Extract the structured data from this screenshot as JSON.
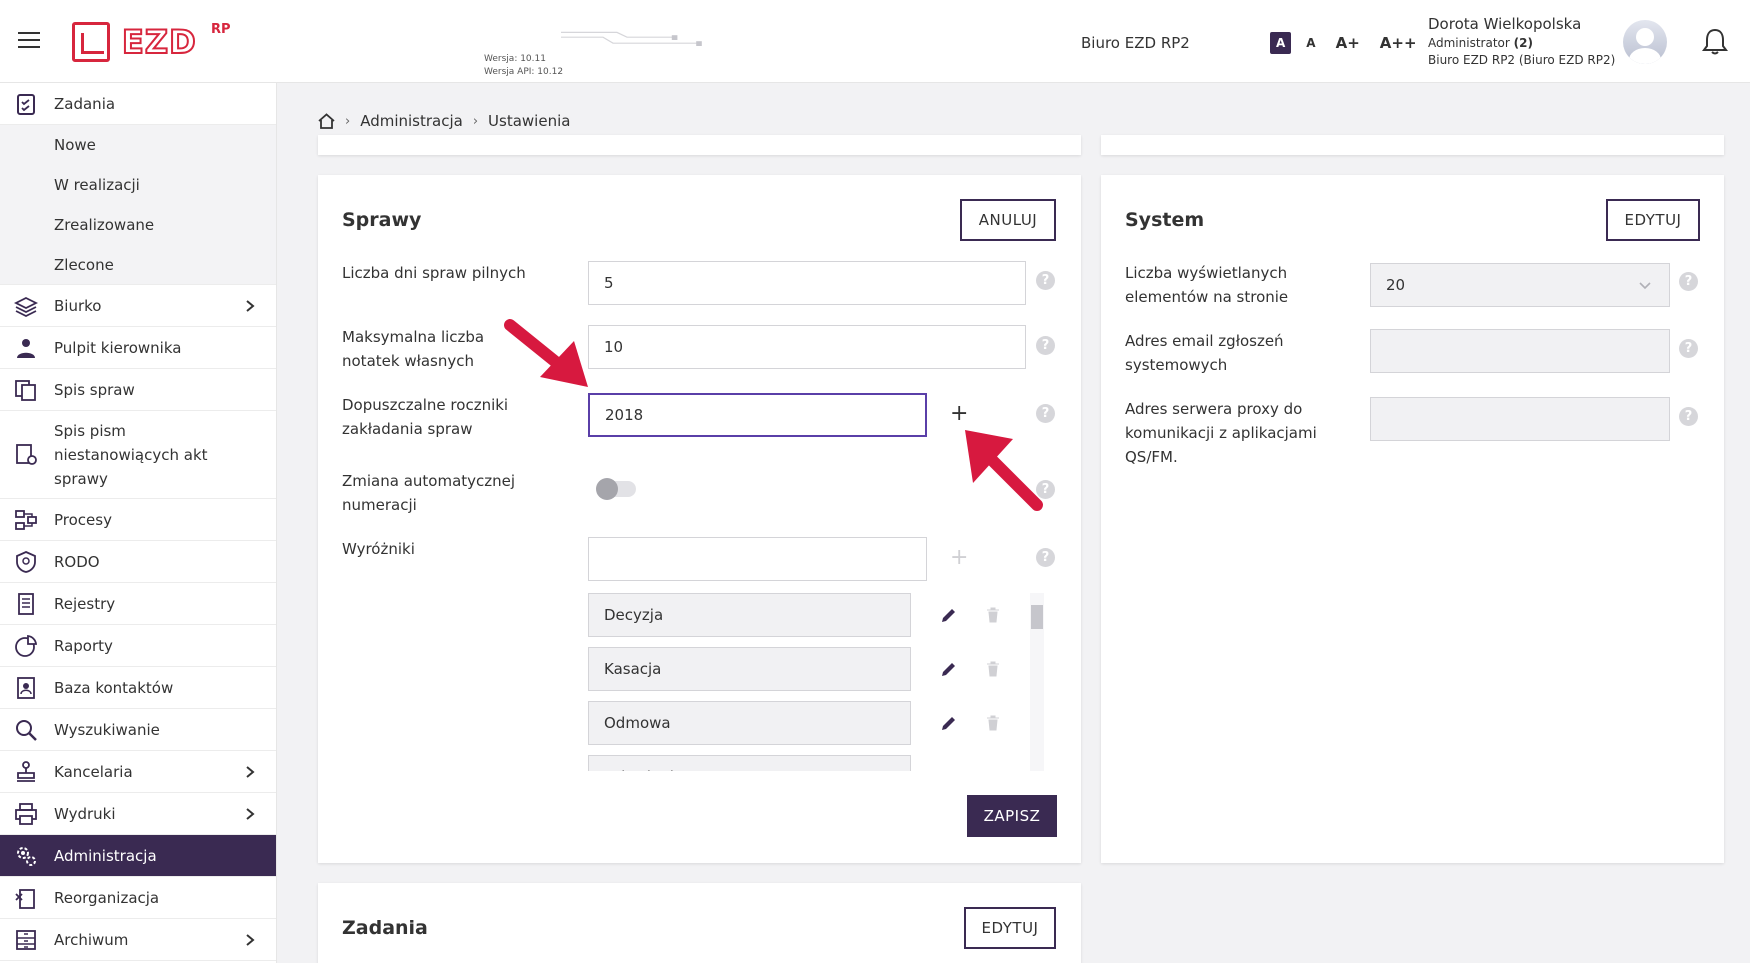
{
  "header": {
    "logo_text": "EZD",
    "logo_sup": "RP",
    "version": "Wersja: 10.11",
    "api_version": "Wersja API: 10.12",
    "organization": "Biuro EZD RP2",
    "font_sizes": [
      "A",
      "A",
      "A+",
      "A++"
    ],
    "user": {
      "name": "Dorota Wielkopolska",
      "role": "Administrator",
      "role_count": "(2)",
      "unit": "Biuro EZD RP2 (Biuro EZD RP2)"
    }
  },
  "sidebar": {
    "items": [
      {
        "label": "Zadania",
        "icon": "clipboard-check-icon"
      },
      {
        "label": "Nowe"
      },
      {
        "label": "W realizacji"
      },
      {
        "label": "Zrealizowane"
      },
      {
        "label": "Zlecone"
      },
      {
        "label": "Biurko",
        "icon": "layers-icon"
      },
      {
        "label": "Pulpit kierownika",
        "icon": "manager-icon"
      },
      {
        "label": "Spis spraw",
        "icon": "documents-icon"
      },
      {
        "label": "Spis pism niestanowiących akt sprawy",
        "icon": "document-share-icon"
      },
      {
        "label": "Procesy",
        "icon": "process-icon"
      },
      {
        "label": "RODO",
        "icon": "shield-icon"
      },
      {
        "label": "Rejestry",
        "icon": "register-icon"
      },
      {
        "label": "Raporty",
        "icon": "pie-chart-icon"
      },
      {
        "label": "Baza kontaktów",
        "icon": "contacts-icon"
      },
      {
        "label": "Wyszukiwanie",
        "icon": "search-icon"
      },
      {
        "label": "Kancelaria",
        "icon": "stamp-icon"
      },
      {
        "label": "Wydruki",
        "icon": "printer-icon"
      },
      {
        "label": "Administracja",
        "icon": "gears-icon"
      },
      {
        "label": "Reorganizacja",
        "icon": "reorganize-icon"
      },
      {
        "label": "Archiwum",
        "icon": "archive-icon"
      }
    ]
  },
  "breadcrumb": {
    "home_icon": "home-icon",
    "items": [
      "Administracja",
      "Ustawienia"
    ]
  },
  "sprawy": {
    "title": "Sprawy",
    "cancel_label": "ANULUJ",
    "save_label": "ZAPISZ",
    "urgent_days_label": "Liczba dni spraw pilnych",
    "urgent_days_value": "5",
    "max_notes_label": "Maksymalna liczba notatek własnych",
    "max_notes_value": "10",
    "years_label": "Dopuszczalne roczniki zakładania spraw",
    "years_value": "2018",
    "auto_numbering_label": "Zmiana automatycznej numeracji",
    "auto_numbering_on": false,
    "markers_label": "Wyróżniki",
    "markers_value": "",
    "markers": [
      "Decyzja",
      "Kasacja",
      "Odmowa",
      "Odwołanie"
    ]
  },
  "system": {
    "title": "System",
    "edit_label": "EDYTUJ",
    "items_per_page_label": "Liczba wyświetlanych elementów na stronie",
    "items_per_page_value": "20",
    "email_label": "Adres email zgłoszeń systemowych",
    "email_value": "",
    "proxy_label": "Adres serwera proxy do komunikacji z aplikacjami QS/FM.",
    "proxy_value": ""
  },
  "zadania": {
    "title": "Zadania",
    "edit_label": "EDYTUJ"
  },
  "colors": {
    "primary": "#3a2a52",
    "accent": "#d7263d",
    "focus": "#5a3fa8"
  }
}
